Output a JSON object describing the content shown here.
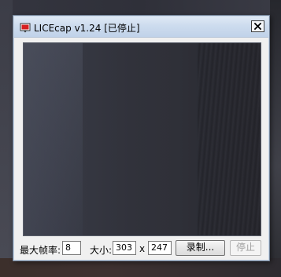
{
  "window": {
    "title": "LICEcap v1.24 [已停止]"
  },
  "icons": {
    "app": "licecap-app-icon",
    "close": "close-icon"
  },
  "controls": {
    "max_fps_label": "最大帧率:",
    "max_fps_value": "8",
    "size_label": "大小:",
    "width_value": "303",
    "times_label": "x",
    "height_value": "247",
    "record_button": "录制...",
    "stop_button": "停止"
  },
  "colors": {
    "titlebar": "#cddcee",
    "window_body": "#f0f0f0",
    "app_icon_red": "#d62020"
  }
}
